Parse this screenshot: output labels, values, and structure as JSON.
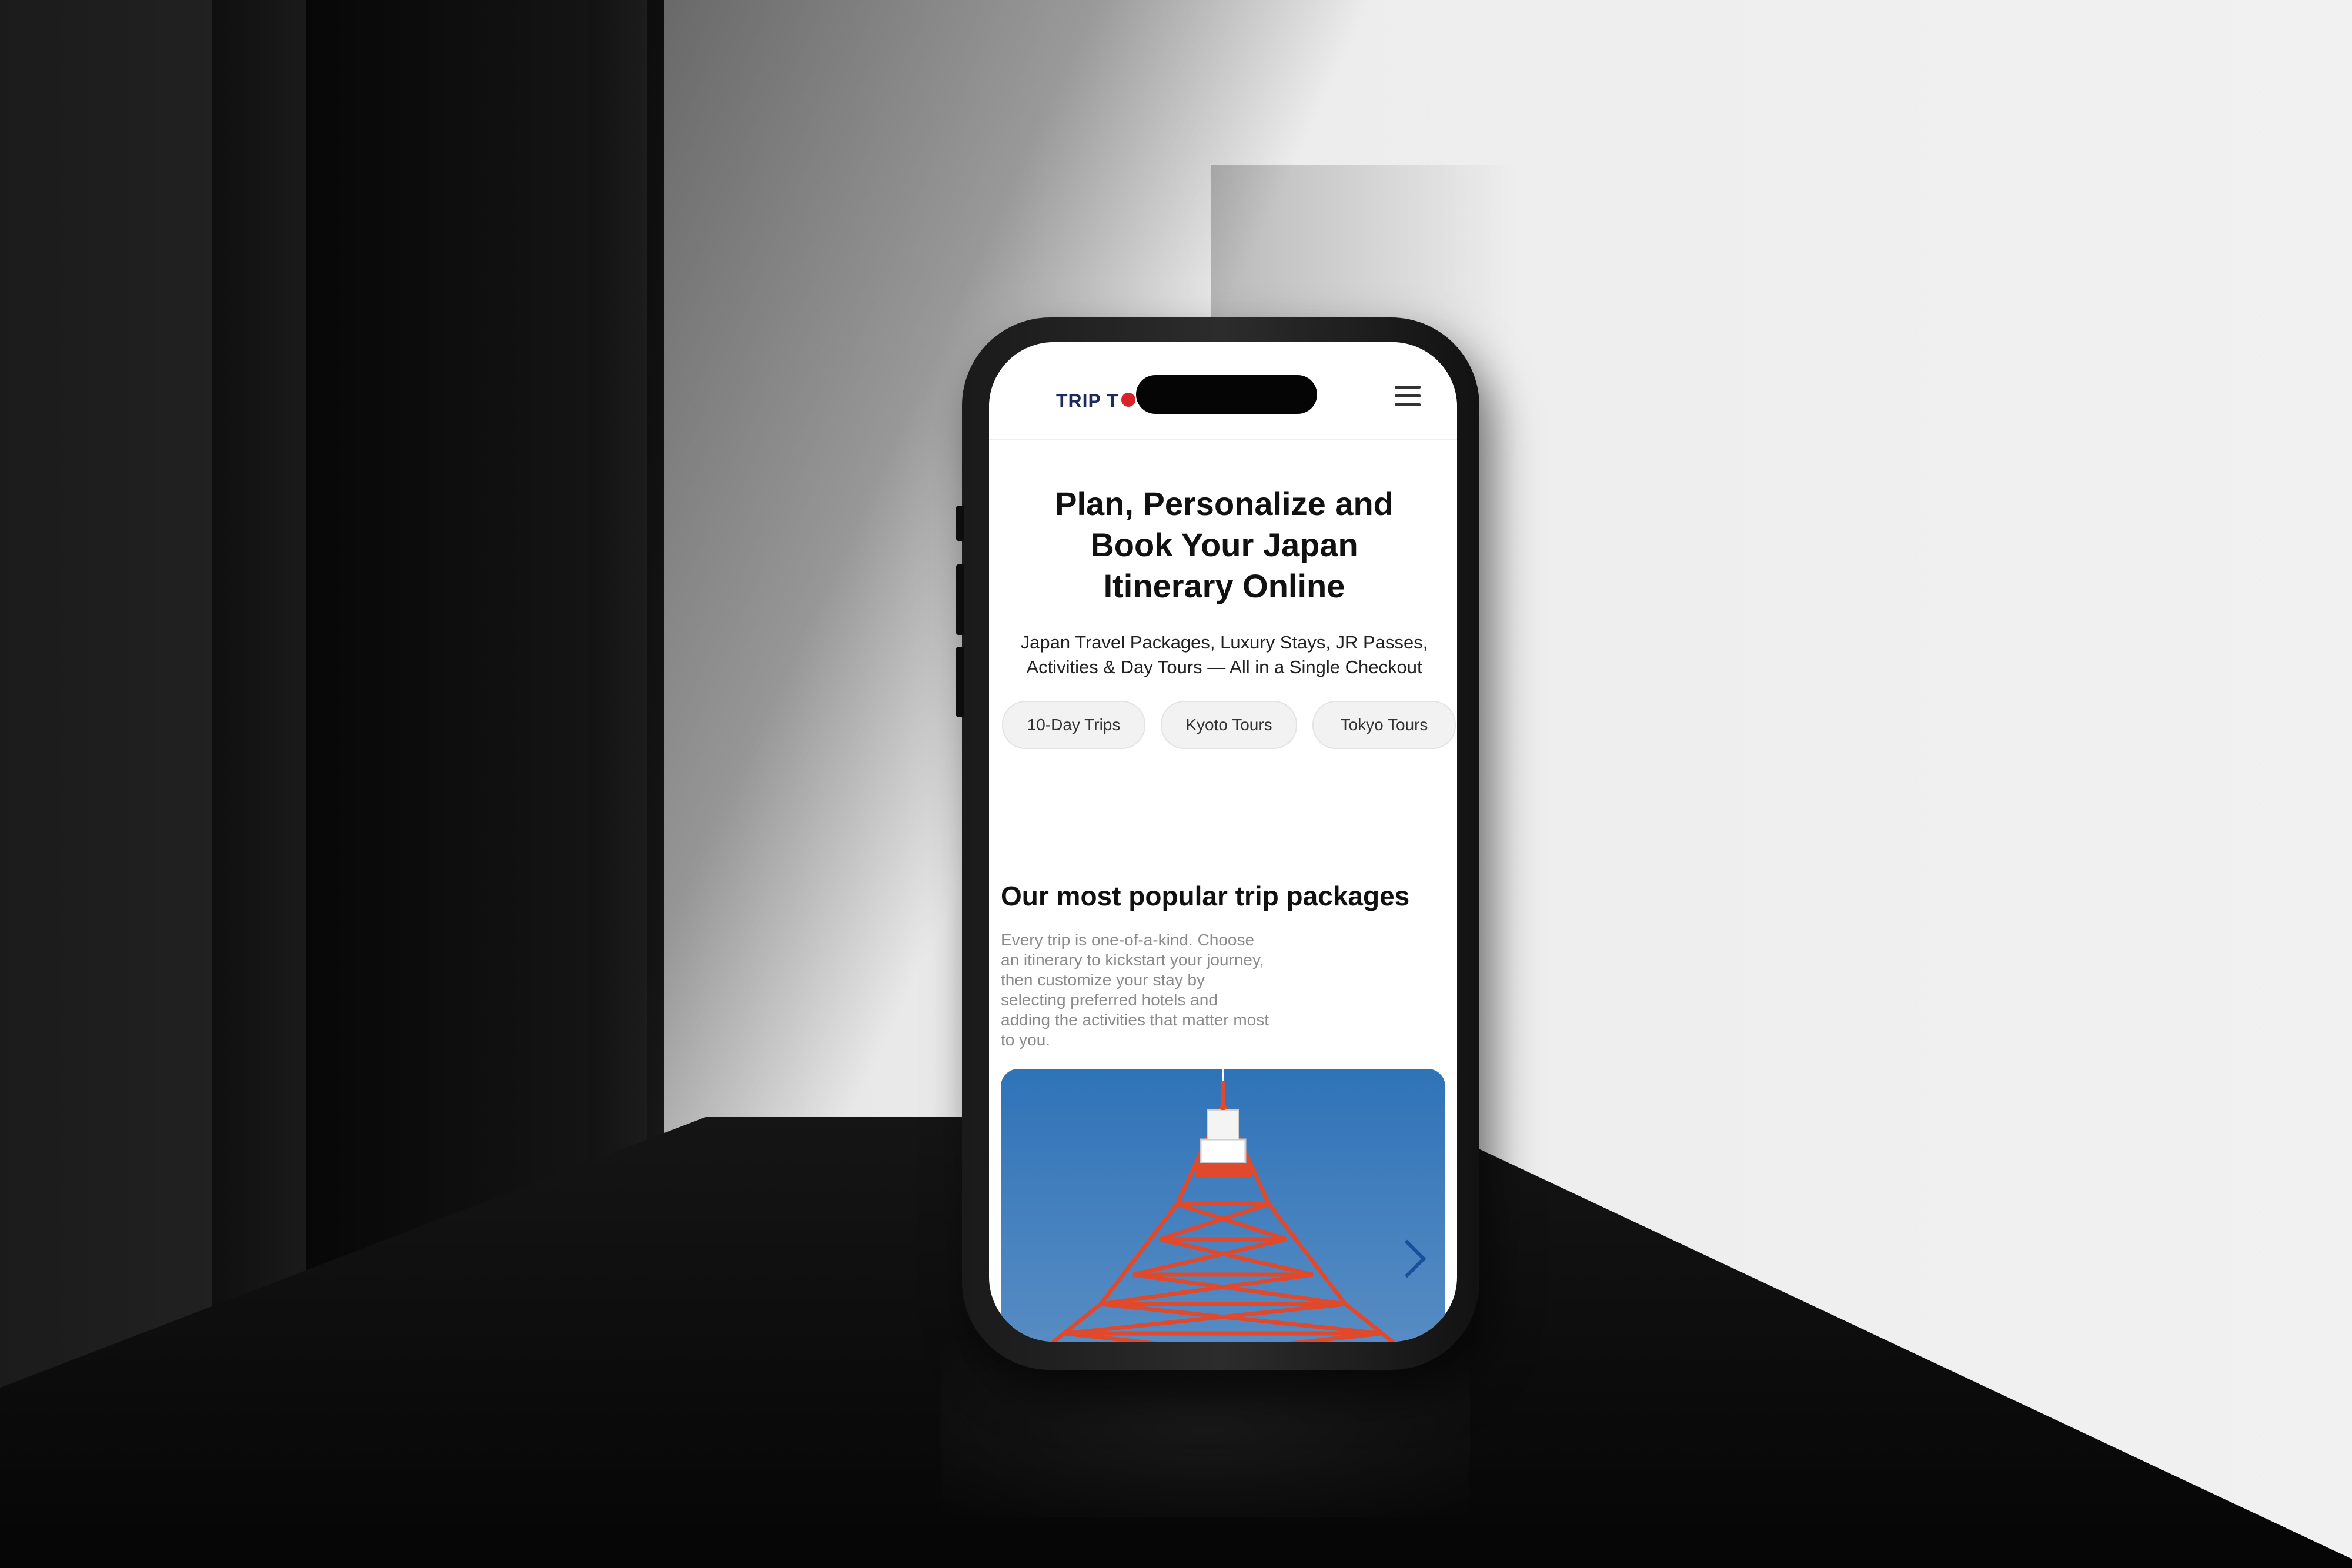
{
  "header": {
    "logo_text": "TRIP T",
    "logo_dot_color": "#d8232a",
    "menu_icon": "hamburger-menu-icon"
  },
  "hero": {
    "title": "Plan, Personalize and Book Your Japan Itinerary Online",
    "subtitle": "Japan Travel Packages, Luxury Stays, JR Passes, Activities & Day Tours — All in a Single Checkout"
  },
  "chips": [
    {
      "label": "10-Day Trips"
    },
    {
      "label": "Kyoto Tours"
    },
    {
      "label": "Tokyo Tours"
    }
  ],
  "popular": {
    "title": "Our most popular trip packages",
    "description": "Every trip is one-of-a-kind. Choose an itinerary to kickstart your journey, then customize your stay by selecting preferred hotels and adding the activities that matter most to you."
  },
  "carousel": {
    "image_subject": "Tokyo Tower",
    "next_icon": "chevron-right-icon",
    "sky_color": "#2f73b8",
    "tower_color": "#d8452a"
  }
}
